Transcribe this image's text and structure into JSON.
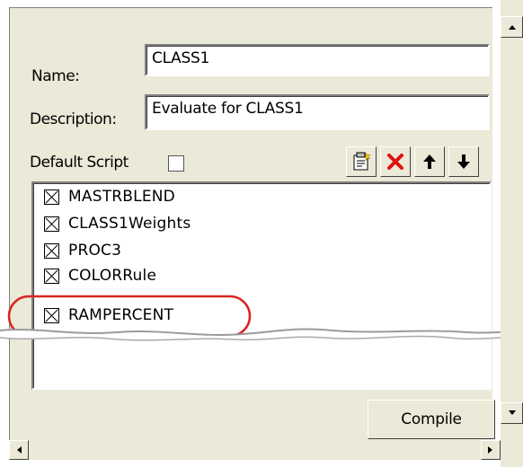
{
  "form": {
    "name_label": "Name:",
    "name_value": "CLASS1",
    "description_label": "Description:",
    "description_value": "Evaluate for CLASS1",
    "default_script_label": "Default Script",
    "default_script_checked": false
  },
  "toolbar": {
    "icons": [
      "new-item-icon",
      "delete-icon",
      "move-up-icon",
      "move-down-icon"
    ]
  },
  "list": {
    "items": [
      {
        "label": "MASTRBLEND",
        "checked": true
      },
      {
        "label": "CLASS1Weights",
        "checked": true
      },
      {
        "label": "PROC3",
        "checked": true
      },
      {
        "label": "COLORRule",
        "checked": true
      },
      {
        "label": "RAMPERCENT",
        "checked": true
      }
    ]
  },
  "buttons": {
    "compile_label": "Compile"
  },
  "colors": {
    "highlight": "#dd2222",
    "panel": "#ebe9d7"
  }
}
